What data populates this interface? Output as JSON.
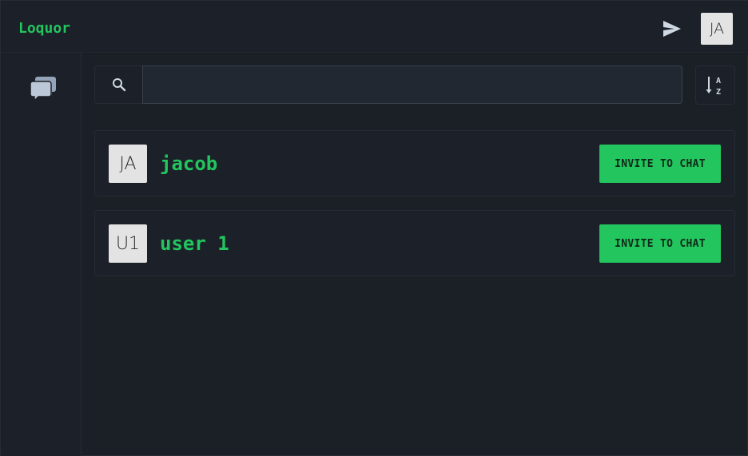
{
  "app": {
    "brand": "Loquor",
    "user_initials": "JA",
    "accent_color": "#22c55e"
  },
  "header": {
    "send_icon": "send-icon"
  },
  "sidebar": {
    "items": [
      {
        "icon": "chat-bubbles-icon"
      }
    ]
  },
  "search": {
    "value": "",
    "placeholder": "",
    "icon": "search-icon"
  },
  "sort": {
    "icon": "sort-alpha-down-icon"
  },
  "users": [
    {
      "initials": "JA",
      "name": "jacob",
      "action_label": "INVITE TO CHAT"
    },
    {
      "initials": "U1",
      "name": "user 1",
      "action_label": "INVITE TO CHAT"
    }
  ]
}
